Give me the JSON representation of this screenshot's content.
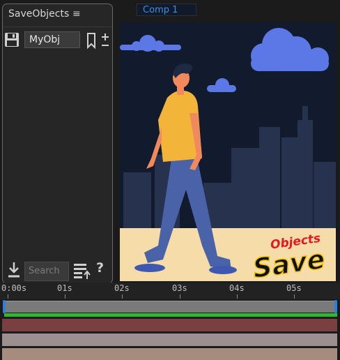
{
  "comp_tab": {
    "label": "Comp 1"
  },
  "panel": {
    "title": "SaveObjects",
    "menu_glyph": "≡",
    "object_name": "MyObj",
    "search_placeholder": "Search ...",
    "help_label": "?"
  },
  "timeline": {
    "time_labels": [
      "0:00s",
      "01s",
      "02s",
      "03s",
      "04s",
      "05s"
    ]
  },
  "viewer": {
    "logo_line1": "Objects",
    "logo_line2": "Save"
  },
  "colors": {
    "accent": "#3d8fe3",
    "sky": "#121a2e",
    "ground": "#f5dca8",
    "shirt": "#f3b43a",
    "pants": "#4a63a8",
    "logo_red": "#e01b24"
  }
}
